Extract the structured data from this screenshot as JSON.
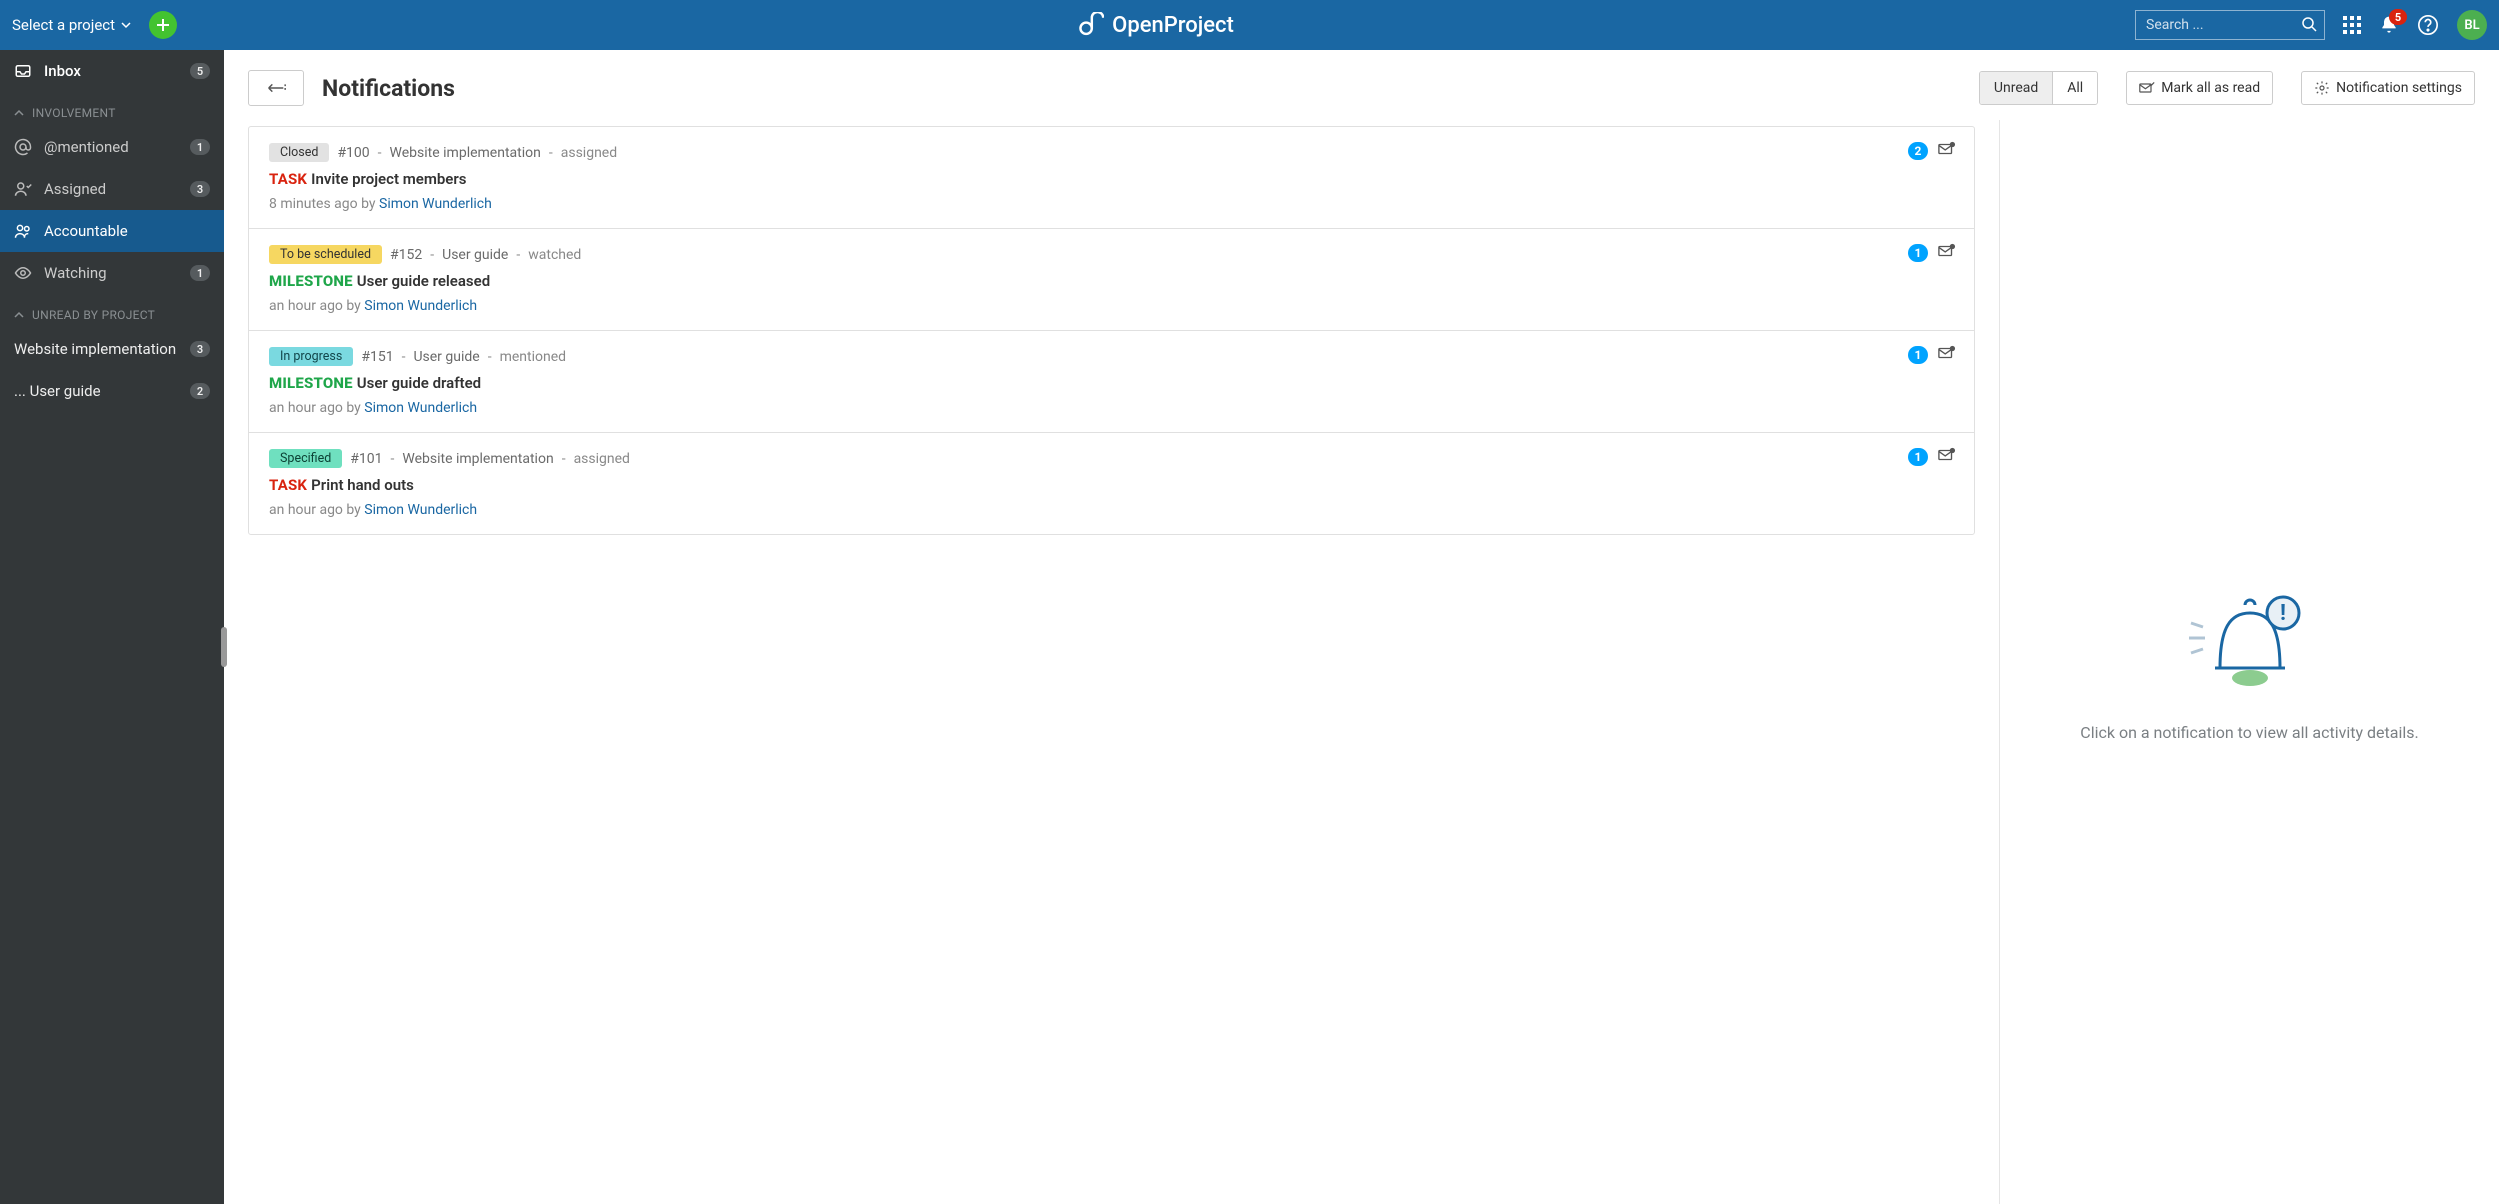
{
  "topbar": {
    "project_select": "Select a project",
    "logo_text": "OpenProject",
    "search_placeholder": "Search ...",
    "bell_count": "5",
    "avatar_initials": "BL"
  },
  "sidebar": {
    "inbox": {
      "label": "Inbox",
      "count": "5"
    },
    "involvement_header": "Involvement",
    "involvement": [
      {
        "label": "@mentioned",
        "count": "1"
      },
      {
        "label": "Assigned",
        "count": "3"
      },
      {
        "label": "Accountable",
        "count": ""
      },
      {
        "label": "Watching",
        "count": "1"
      }
    ],
    "unread_header": "Unread by project",
    "projects": [
      {
        "label": "Website implementation",
        "count": "3"
      },
      {
        "label": "... User guide",
        "count": "2"
      }
    ]
  },
  "header": {
    "title": "Notifications",
    "unread": "Unread",
    "all": "All",
    "mark_all": "Mark all as read",
    "settings": "Notification settings"
  },
  "status_colors": {
    "Closed": {
      "bg": "#e2e2e2",
      "fg": "#333"
    },
    "To be scheduled": {
      "bg": "#f6d761",
      "fg": "#333"
    },
    "In progress": {
      "bg": "#7ad9e0",
      "fg": "#12464b"
    },
    "Specified": {
      "bg": "#6fe0bf",
      "fg": "#0c4235"
    }
  },
  "notifications": [
    {
      "status": "Closed",
      "wp_id": "#100",
      "project": "Website implementation",
      "reason": "assigned",
      "type": "TASK",
      "subject": "Invite project members",
      "time": "8 minutes ago by",
      "actor": "Simon Wunderlich",
      "count": "2"
    },
    {
      "status": "To be scheduled",
      "wp_id": "#152",
      "project": "User guide",
      "reason": "watched",
      "type": "MILESTONE",
      "subject": "User guide released",
      "time": "an hour ago by",
      "actor": "Simon Wunderlich",
      "count": "1"
    },
    {
      "status": "In progress",
      "wp_id": "#151",
      "project": "User guide",
      "reason": "mentioned",
      "type": "MILESTONE",
      "subject": "User guide drafted",
      "time": "an hour ago by",
      "actor": "Simon Wunderlich",
      "count": "1"
    },
    {
      "status": "Specified",
      "wp_id": "#101",
      "project": "Website implementation",
      "reason": "assigned",
      "type": "TASK",
      "subject": "Print hand outs",
      "time": "an hour ago by",
      "actor": "Simon Wunderlich",
      "count": "1"
    }
  ],
  "detail": {
    "empty_text": "Click on a notification to view all activity details."
  }
}
